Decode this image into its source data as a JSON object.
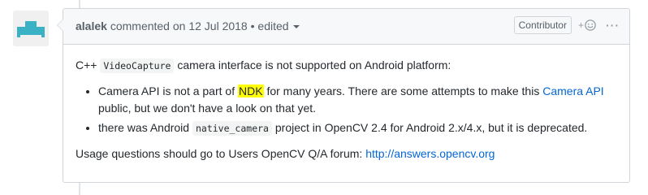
{
  "comment": {
    "author": "alalek",
    "action_text": "commented on 12 Jul 2018",
    "separator": "•",
    "edited_label": "edited",
    "role_badge": "Contributor",
    "reaction_plus": "+",
    "more_label": "···",
    "body": {
      "intro_prefix": "C++",
      "intro_code": "VideoCapture",
      "intro_suffix": "camera interface is not supported on Android platform:",
      "bullet1_part1": "Camera API is not a part of",
      "bullet1_highlight": "NDK",
      "bullet1_part2": "for many years. There are some attempts to make this",
      "bullet1_link": "Camera API",
      "bullet1_part3": "public, but we don't have a look on that yet.",
      "bullet2_part1": "there was Android",
      "bullet2_code": "native_camera",
      "bullet2_part2": "project in OpenCV 2.4 for Android 2.x/4.x, but it is deprecated.",
      "footer_text": "Usage questions should go to Users OpenCV Q/A forum:",
      "footer_link": "http://answers.opencv.org"
    }
  },
  "colors": {
    "avatar_accent": "#3ab1c5",
    "link": "#0366d6",
    "highlight": "#ffff00",
    "header_bg": "#f6f8fa"
  },
  "icons": {
    "avatar": "identicon",
    "reaction": "smiley-icon",
    "edited_dropdown": "caret-down-icon",
    "more": "kebab-horizontal-icon"
  }
}
